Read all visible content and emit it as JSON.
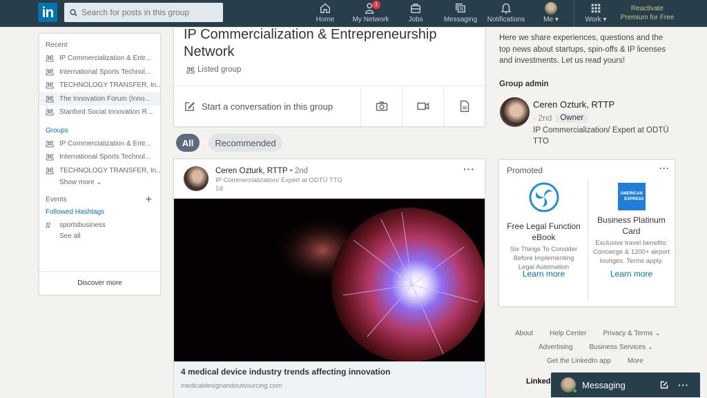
{
  "nav": {
    "logo": "in",
    "search_placeholder": "Search for posts in this group",
    "items": [
      {
        "label": "Home",
        "icon": "home-icon"
      },
      {
        "label": "My Network",
        "icon": "network-icon",
        "badge": "1"
      },
      {
        "label": "Jobs",
        "icon": "briefcase-icon"
      },
      {
        "label": "Messaging",
        "icon": "messaging-icon"
      },
      {
        "label": "Notifications",
        "icon": "bell-icon"
      },
      {
        "label": "Me",
        "icon": "avatar"
      },
      {
        "label": "Work",
        "icon": "grid-icon"
      }
    ],
    "premium_line1": "Reactivate",
    "premium_line2": "Premium for Free"
  },
  "sidebar": {
    "recent_label": "Recent",
    "recent": [
      "IP Commercialization & Entr...",
      "International Sports Technol...",
      "TECHNOLOGY TRANSFER, In...",
      "The Innovation Forum (Inno...",
      "Stanford Social Innovation R..."
    ],
    "groups_label": "Groups",
    "groups": [
      "IP Commercialization & Entr...",
      "International Sports Technol...",
      "TECHNOLOGY TRANSFER, In..."
    ],
    "show_more": "Show more",
    "events_label": "Events",
    "hashtags_label": "Followed Hashtags",
    "hashtag": "sportsbusiness",
    "see_all": "See all",
    "discover_more": "Discover more"
  },
  "group": {
    "title": "IP Commercialization & Entrepreneurship Network",
    "type": "Listed group",
    "share_prompt": "Start a conversation in this group"
  },
  "filters": {
    "all": "All",
    "recommended": "Recommended"
  },
  "post": {
    "author": "Ceren Ozturk, RTTP",
    "degree": "• 2nd",
    "headline": "IP Commercialization/ Expert at ODTÜ TTO",
    "time": "1d",
    "link_title": "4 medical device industry trends affecting innovation",
    "link_source": "medicaldesignandoutsourcing.com"
  },
  "about": {
    "description": "Here we share experiences, questions and the top news about startups, spin-offs & IP licenses and investments. Let us read yours!",
    "admin_label": "Group admin",
    "admin_name": "Ceren Ozturk, RTTP",
    "admin_degree": "· 2nd",
    "admin_role": "Owner",
    "admin_headline": "IP Commercialization/ Expert at ODTÜ TTO"
  },
  "promoted": {
    "label": "Promoted",
    "ads": [
      {
        "title": "Free Legal Function eBook",
        "desc": "Six Things To Consider Before Implementing Legal Automation",
        "cta": "Learn more",
        "color": "#1a8fd6"
      },
      {
        "title": "Business Platinum Card",
        "desc": "Exclusive travel benefits: Concierge & 1200+ airport lounges. Terms apply.",
        "cta": "Learn more",
        "color": "#1f7fd8",
        "logo_line1": "AMERICAN",
        "logo_line2": "EXPRESS"
      }
    ]
  },
  "footer": {
    "row1": [
      "About",
      "Help Center",
      "Privacy & Terms"
    ],
    "row2": [
      "Advertising",
      "Business Services"
    ],
    "row3": [
      "Get the LinkedIn app",
      "More"
    ],
    "brand": "Linked"
  },
  "messaging": {
    "label": "Messaging"
  },
  "colors": {
    "nav_bg": "#283e4a",
    "brand_blue": "#0073b1",
    "badge_red": "#e0393e"
  }
}
